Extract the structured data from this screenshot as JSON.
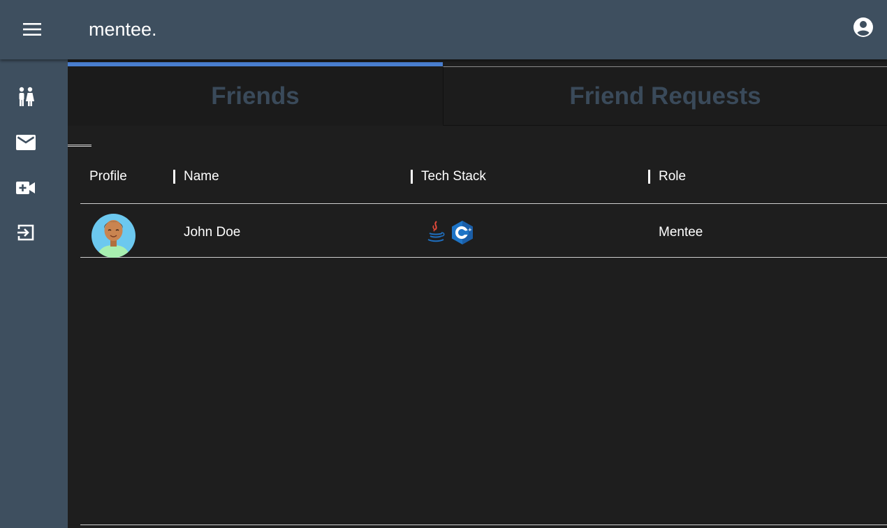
{
  "header": {
    "title": "mentee.",
    "menu_icon": "hamburger-menu-icon",
    "account_icon": "account-circle-icon"
  },
  "sidebar": {
    "items": [
      {
        "icon": "people-icon"
      },
      {
        "icon": "mail-icon"
      },
      {
        "icon": "video-call-icon"
      },
      {
        "icon": "logout-icon"
      }
    ]
  },
  "tabs": [
    {
      "label": "Friends",
      "active": true
    },
    {
      "label": "Friend Requests",
      "active": false
    }
  ],
  "table": {
    "columns": [
      "Profile",
      "Name",
      "Tech Stack",
      "Role"
    ],
    "rows": [
      {
        "avatar": "avatar-icon",
        "name": "John Doe",
        "tech_stack": [
          "java-icon",
          "cplusplus-icon"
        ],
        "role": "Mentee"
      }
    ]
  },
  "colors": {
    "header_bg": "#3e4f5f",
    "page_bg": "#1e1e1e",
    "tab_text": "#3a4a5a",
    "tab_indicator": "#4a7fd0"
  }
}
